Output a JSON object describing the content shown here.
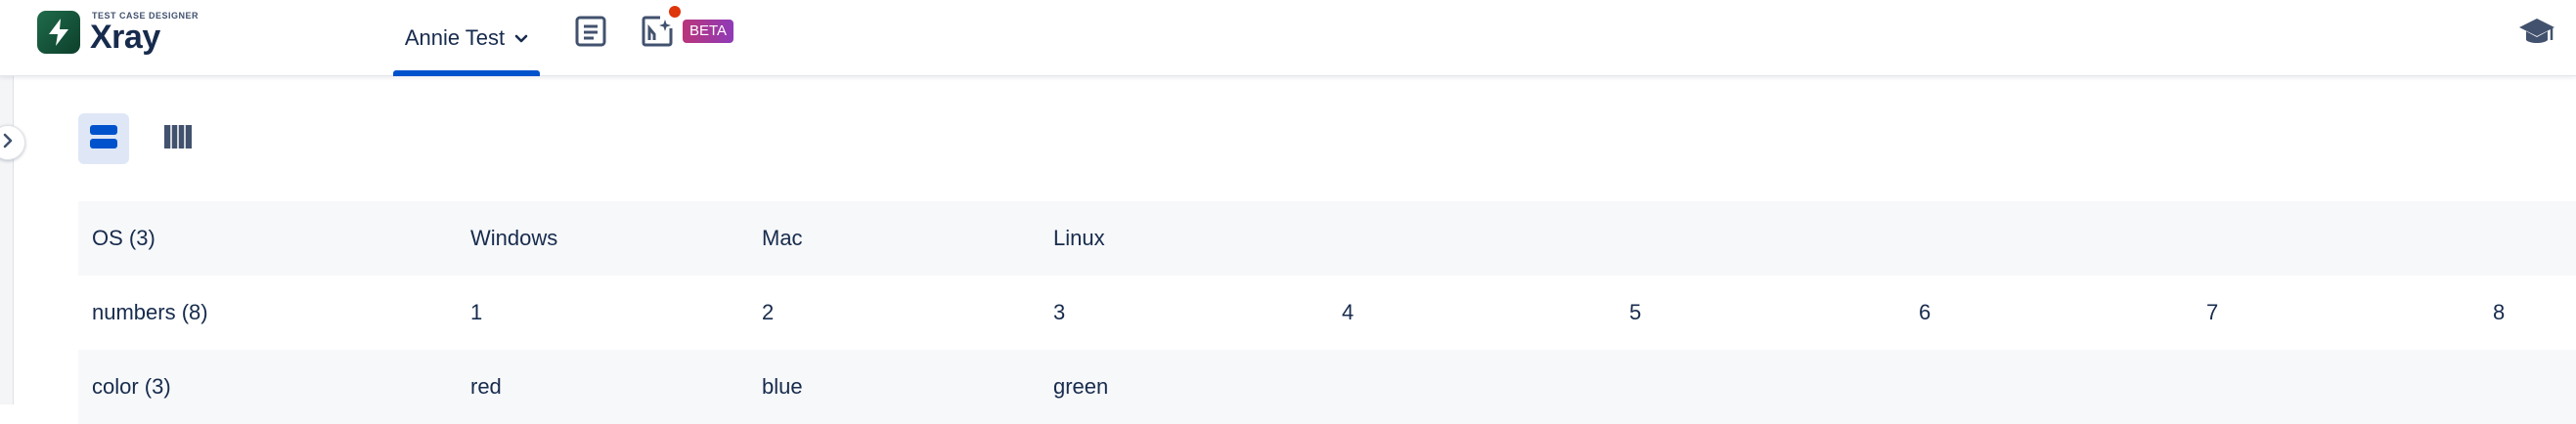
{
  "brand": {
    "subtitle": "TEST CASE DESIGNER",
    "name": "Xray",
    "color": "#1f6b4a"
  },
  "header": {
    "project_label": "Annie Test",
    "beta_badge": "BETA",
    "accent": "#0052cc",
    "icons": [
      "document-icon",
      "ai-assistant-icon",
      "graduation-cap-icon",
      "chevron-down-icon"
    ]
  },
  "view": {
    "modes": [
      "rows-view",
      "columns-view"
    ],
    "selected": "rows-view"
  },
  "parameters": [
    {
      "name": "OS (3)",
      "values": [
        "Windows",
        "Mac",
        "Linux"
      ]
    },
    {
      "name": "numbers (8)",
      "values": [
        "1",
        "2",
        "3",
        "4",
        "5",
        "6",
        "7",
        "8"
      ]
    },
    {
      "name": "color (3)",
      "values": [
        "red",
        "blue",
        "green"
      ]
    }
  ]
}
